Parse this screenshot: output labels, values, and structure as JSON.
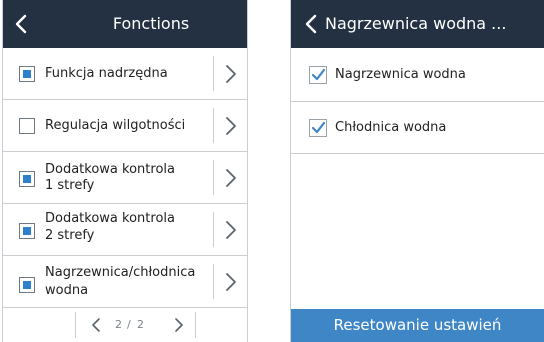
{
  "left_panel": {
    "title": "Fonctions",
    "items": [
      {
        "label_line1": "Funkcja nadrzędna",
        "label_line2": "",
        "checked": true
      },
      {
        "label_line1": "Regulacja wilgotności",
        "label_line2": "",
        "checked": false
      },
      {
        "label_line1": "Dodatkowa kontrola",
        "label_line2": "1 strefy",
        "checked": true
      },
      {
        "label_line1": "Dodatkowa kontrola",
        "label_line2": "2 strefy",
        "checked": true
      },
      {
        "label_line1": "Nagrzewnica/chłodnica",
        "label_line2": "wodna",
        "checked": true
      }
    ],
    "pager": {
      "current": "2",
      "separator": "/",
      "total": "2"
    }
  },
  "right_panel": {
    "title": "Nagrzewnica wodna ...",
    "items": [
      {
        "label": "Nagrzewnica wodna",
        "checked": true
      },
      {
        "label": "Chłodnica wodna",
        "checked": true
      }
    ],
    "reset_label": "Resetowanie ustawień"
  },
  "colors": {
    "header_bg": "#233142",
    "checkbox_fill": "#2e7fcc",
    "checkmark": "#3f86c6",
    "reset_bg": "#3f86c6"
  },
  "icons": {
    "back": "chevron-left-icon",
    "forward": "chevron-right-icon",
    "checkmark": "check-icon"
  }
}
